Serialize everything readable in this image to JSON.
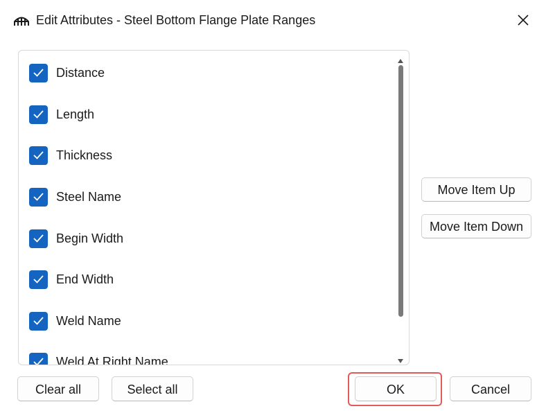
{
  "window": {
    "title": "Edit Attributes - Steel Bottom Flange Plate Ranges",
    "icon": "bridge-icon",
    "close_label": "close-icon"
  },
  "list": {
    "items": [
      {
        "label": "Distance",
        "checked": true
      },
      {
        "label": "Length",
        "checked": true
      },
      {
        "label": "Thickness",
        "checked": true
      },
      {
        "label": "Steel Name",
        "checked": true
      },
      {
        "label": "Begin Width",
        "checked": true
      },
      {
        "label": "End Width",
        "checked": true
      },
      {
        "label": "Weld Name",
        "checked": true
      },
      {
        "label": "Weld At Right Name",
        "checked": true
      }
    ]
  },
  "side_buttons": {
    "move_up": "Move Item Up",
    "move_down": "Move Item Down"
  },
  "footer": {
    "clear_all": "Clear all",
    "select_all": "Select all",
    "ok": "OK",
    "cancel": "Cancel"
  },
  "colors": {
    "checkbox": "#1565c0",
    "highlight": "#e05a5a",
    "scroll_thumb": "#7a7a7a"
  }
}
